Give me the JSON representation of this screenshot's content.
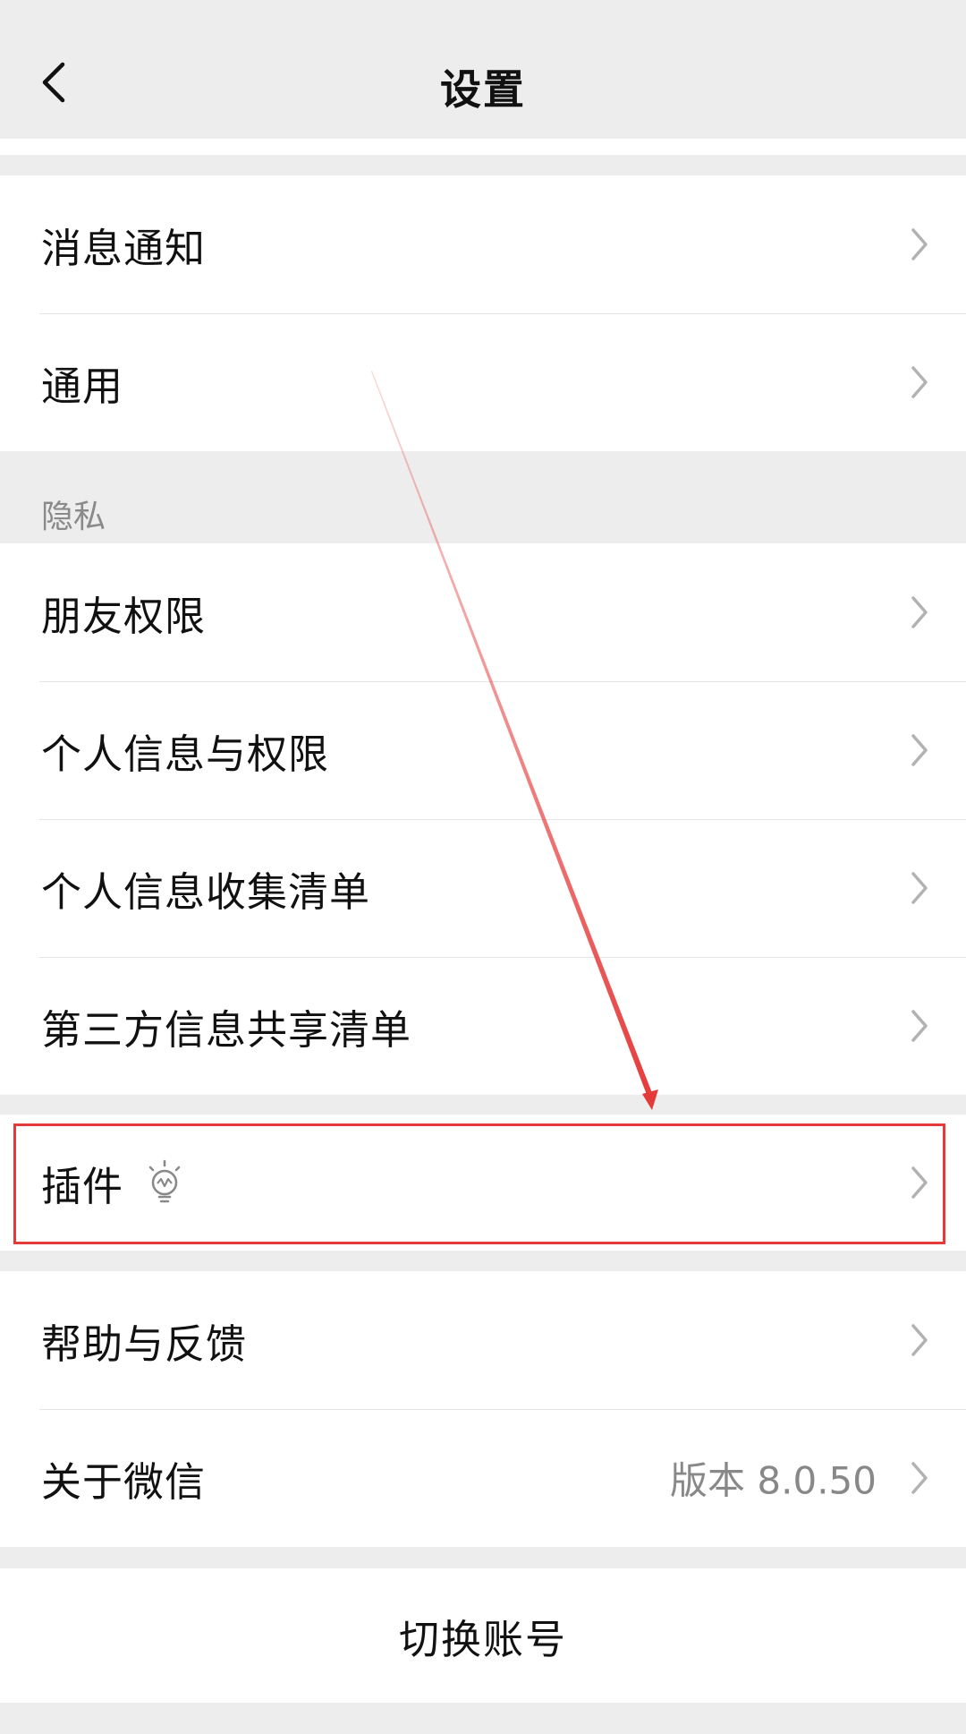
{
  "nav": {
    "title": "设置"
  },
  "group1": [
    {
      "label": "消息通知"
    },
    {
      "label": "通用"
    }
  ],
  "privacy": {
    "header": "隐私",
    "items": [
      {
        "label": "朋友权限"
      },
      {
        "label": "个人信息与权限"
      },
      {
        "label": "个人信息收集清单"
      },
      {
        "label": "第三方信息共享清单"
      }
    ]
  },
  "plugins": {
    "label": "插件",
    "icon": "lightbulb-icon"
  },
  "group4": [
    {
      "label": "帮助与反馈"
    },
    {
      "label": "关于微信",
      "value": "版本 8.0.50"
    }
  ],
  "switch_account": "切换账号",
  "colors": {
    "background": "#ededed",
    "annotation": "#e53a3a",
    "chevron": "#b2b2b2"
  }
}
